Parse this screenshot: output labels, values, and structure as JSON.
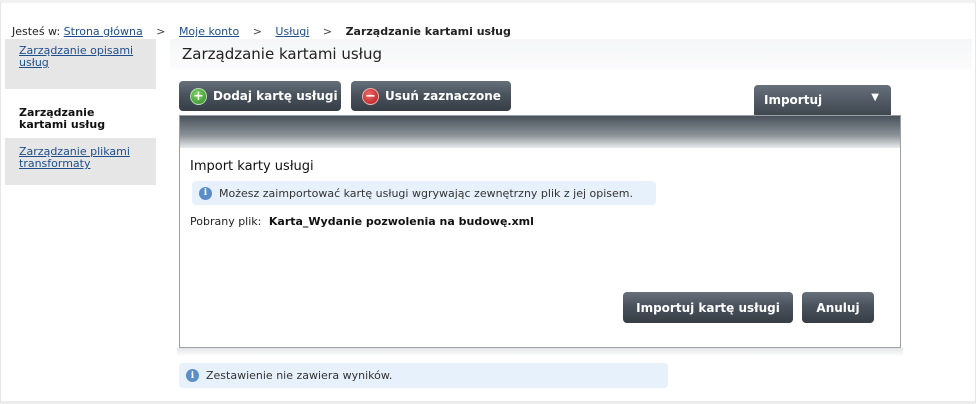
{
  "breadcrumb": {
    "prefix": "Jesteś w:",
    "items": [
      "Strona główna",
      "Moje konto",
      "Usługi"
    ],
    "current": "Zarządzanie kartami usług",
    "separator": ">"
  },
  "sidebar": {
    "items": [
      {
        "label": "Zarządzanie opisami usług",
        "active": false
      },
      {
        "label": "Zarządzanie kartami usług",
        "active": true
      },
      {
        "label": "Zarządzanie plikami transformaty",
        "active": false
      }
    ]
  },
  "header": {
    "title": "Zarządzanie kartami usług"
  },
  "toolbar": {
    "add_label": "Dodaj kartę usługi",
    "delete_label": "Usuń zaznaczone",
    "import_tab_label": "Importuj"
  },
  "import_panel": {
    "title": "Import karty usługi",
    "info": "Możesz zaimportować kartę usługi wgrywając zewnętrzny plik z jej opisem.",
    "file_label": "Pobrany plik:",
    "file_name": "Karta_Wydanie pozwolenia na budowę.xml",
    "import_button": "Importuj kartę usługi",
    "cancel_button": "Anuluj"
  },
  "results": {
    "empty_message": "Zestawienie nie zawiera wyników."
  },
  "icons": {
    "add": "plus-circle-icon",
    "delete": "minus-circle-icon",
    "info": "info-icon",
    "dropdown": "chevron-down-icon"
  },
  "colors": {
    "link": "#1f4e8c",
    "button_dark": "#4a535d",
    "info_bg": "#e7f1fb",
    "add_green": "#2f8a1f",
    "delete_red": "#b01515"
  }
}
